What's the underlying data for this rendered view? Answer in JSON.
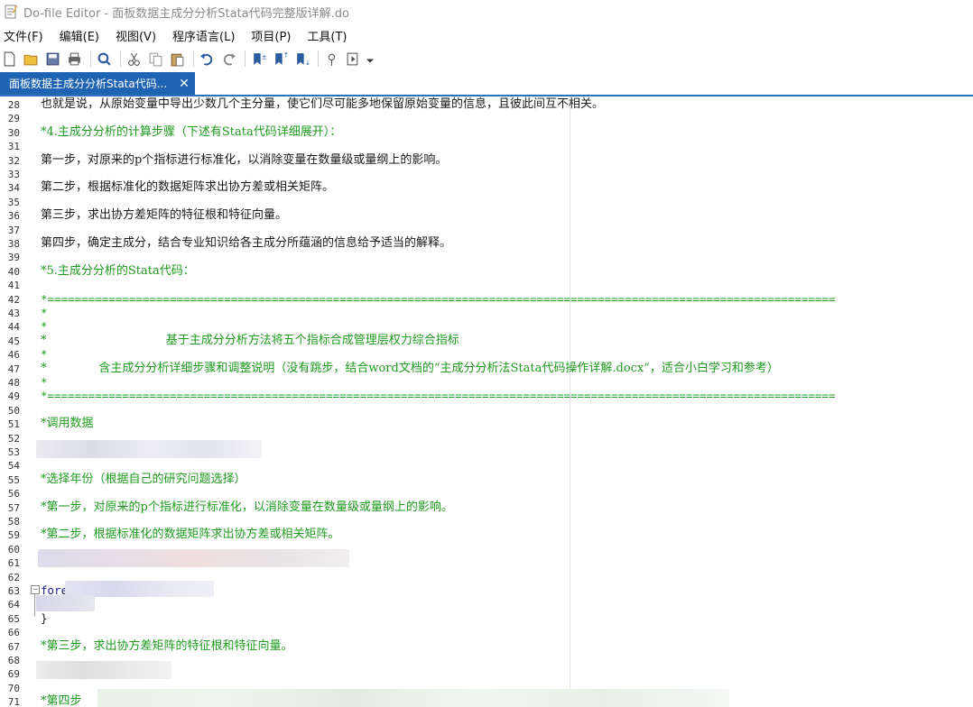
{
  "window": {
    "title": "Do-file Editor - 面板数据主成分分析Stata代码完整版详解.do"
  },
  "menu": [
    "文件(F)",
    "编辑(E)",
    "视图(V)",
    "程序语言(L)",
    "项目(P)",
    "工具(T)"
  ],
  "toolbar": {
    "icons": [
      "new-file-icon",
      "open-folder-icon",
      "save-icon",
      "print-icon",
      "find-icon",
      "cut-icon",
      "copy-icon",
      "paste-icon",
      "undo-icon",
      "redo-icon",
      "bookmark-add-icon",
      "bookmark-prev-icon",
      "bookmark-next-icon",
      "preview-icon",
      "run-do-icon"
    ]
  },
  "tab": {
    "label": "面板数据主成分分析Stata代码...",
    "close": "✕"
  },
  "editor": {
    "lines": [
      {
        "n": "28",
        "text": "也就是说，从原始变量中导出少数几个主分量，使它们尽可能多地保留原始变量的信息，且彼此间互不相关。",
        "style": "cjk"
      },
      {
        "n": "29",
        "text": ""
      },
      {
        "n": "30",
        "text": "*4.主成分分析的计算步骤（下述有Stata代码详细展开）：",
        "style": "comment"
      },
      {
        "n": "31",
        "text": ""
      },
      {
        "n": "32",
        "text": "第一步，对原来的p个指标进行标准化，以消除变量在数量级或量纲上的影响。",
        "style": "cjk"
      },
      {
        "n": "33",
        "text": ""
      },
      {
        "n": "34",
        "text": "第二步，根据标准化的数据矩阵求出协方差或相关矩阵。",
        "style": "cjk"
      },
      {
        "n": "35",
        "text": ""
      },
      {
        "n": "36",
        "text": "第三步，求出协方差矩阵的特征根和特征向量。",
        "style": "cjk"
      },
      {
        "n": "37",
        "text": ""
      },
      {
        "n": "38",
        "text": "第四步，确定主成分，结合专业知识给各主成分所蕴涵的信息给予适当的解释。",
        "style": "cjk"
      },
      {
        "n": "39",
        "text": ""
      },
      {
        "n": "40",
        "text": "*5.主成分分析的Stata代码：",
        "style": "comment"
      },
      {
        "n": "41",
        "text": ""
      },
      {
        "n": "42",
        "text": "*====================================================================================================================",
        "style": "comment"
      },
      {
        "n": "43",
        "text": "*",
        "style": "comment"
      },
      {
        "n": "44",
        "text": "*",
        "style": "comment"
      },
      {
        "n": "45",
        "text": "*                                基于主成分分析方法将五个指标合成管理层权力综合指标",
        "style": "comment"
      },
      {
        "n": "46",
        "text": "*",
        "style": "comment"
      },
      {
        "n": "47",
        "text": "*              含主成分分析详细步骤和调整说明（没有跳步，结合word文档的“主成分分析法Stata代码操作详解.docx”，适合小白学习和参考）",
        "style": "comment"
      },
      {
        "n": "48",
        "text": "*",
        "style": "comment"
      },
      {
        "n": "49",
        "text": "*====================================================================================================================",
        "style": "comment"
      },
      {
        "n": "50",
        "text": ""
      },
      {
        "n": "51",
        "text": "*调用数据",
        "style": "comment"
      },
      {
        "n": "52",
        "text": ""
      },
      {
        "n": "53",
        "text": ""
      },
      {
        "n": "54",
        "text": ""
      },
      {
        "n": "55",
        "text": "*选择年份（根据自己的研究问题选择）",
        "style": "comment"
      },
      {
        "n": "56",
        "text": ""
      },
      {
        "n": "57",
        "text": "*第一步，对原来的p个指标进行标准化，以消除变量在数量级或量纲上的影响。",
        "style": "comment"
      },
      {
        "n": "58",
        "text": ""
      },
      {
        "n": "59",
        "text": "*第二步，根据标准化的数据矩阵求出协方差或相关矩阵。",
        "style": "comment"
      },
      {
        "n": "60",
        "text": ""
      },
      {
        "n": "61",
        "text": ""
      },
      {
        "n": "62",
        "text": ""
      },
      {
        "n": "63",
        "text": "fore",
        "style": "keyword"
      },
      {
        "n": "64",
        "text": ""
      },
      {
        "n": "65",
        "text": "}",
        "style": "plain"
      },
      {
        "n": "66",
        "text": ""
      },
      {
        "n": "67",
        "text": "*第三步，求出协方差矩阵的特征根和特征向量。",
        "style": "comment"
      },
      {
        "n": "68",
        "text": ""
      },
      {
        "n": "69",
        "text": ""
      },
      {
        "n": "70",
        "text": ""
      },
      {
        "n": "71",
        "text": "*第四步",
        "style": "comment"
      }
    ]
  },
  "colors": {
    "comment": "#1e9a1e",
    "tab_active": "#1f63b3",
    "accent": "#2f6fbf"
  }
}
